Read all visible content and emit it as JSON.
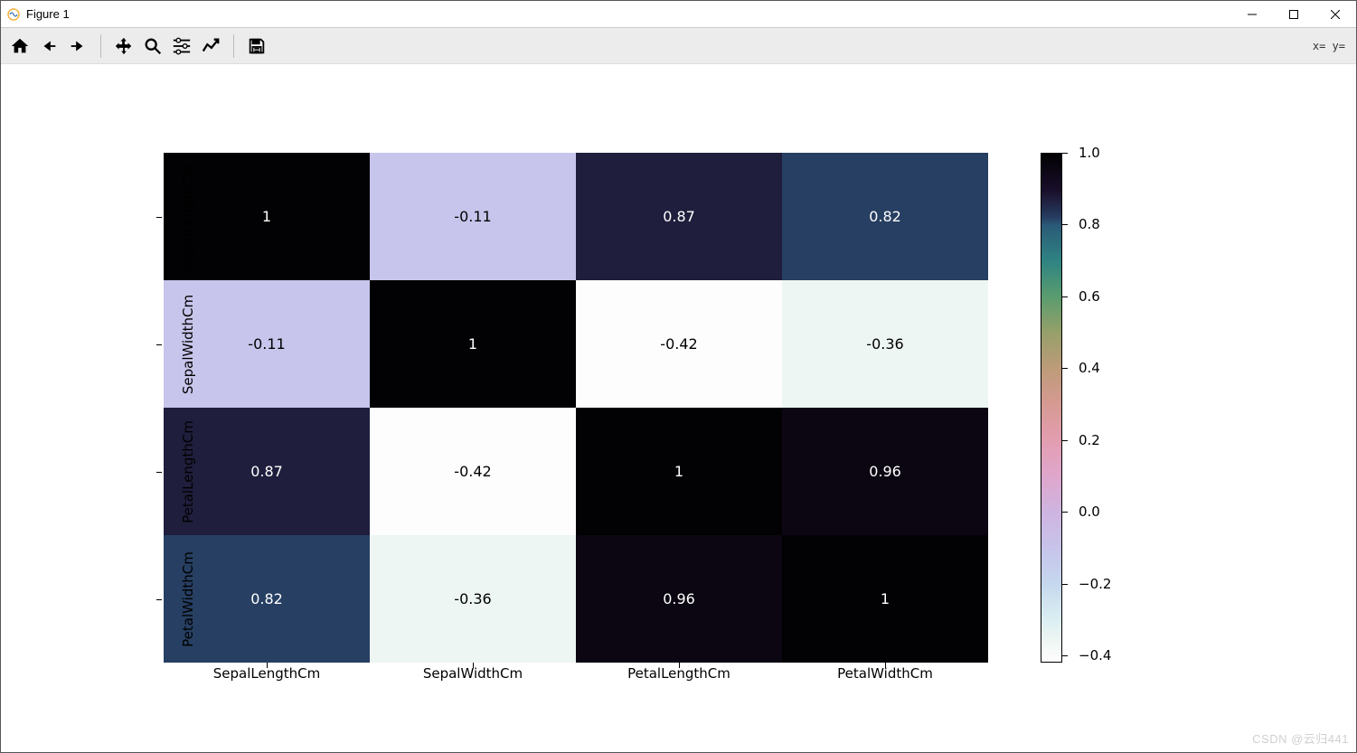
{
  "window": {
    "title": "Figure 1"
  },
  "toolbar": {
    "coord_text": "x=  y="
  },
  "watermark": "CSDN @云归441",
  "chart_data": {
    "type": "heatmap",
    "xlabels": [
      "SepalLengthCm",
      "SepalWidthCm",
      "PetalLengthCm",
      "PetalWidthCm"
    ],
    "ylabels": [
      "SepalLengthCm",
      "SepalWidthCm",
      "PetalLengthCm",
      "PetalWidthCm"
    ],
    "values": [
      [
        1,
        -0.11,
        0.87,
        0.82
      ],
      [
        -0.11,
        1,
        -0.42,
        -0.36
      ],
      [
        0.87,
        -0.42,
        1,
        0.96
      ],
      [
        0.82,
        -0.36,
        0.96,
        1
      ]
    ],
    "annotations": [
      [
        "1",
        "-0.11",
        "0.87",
        "0.82"
      ],
      [
        "-0.11",
        "1",
        "-0.42",
        "-0.36"
      ],
      [
        "0.87",
        "-0.42",
        "1",
        "0.96"
      ],
      [
        "0.82",
        "-0.36",
        "0.96",
        "1"
      ]
    ],
    "vmin": -0.42,
    "vmax": 1.0,
    "colorbar": {
      "ticks": [
        1.0,
        0.8,
        0.6,
        0.4,
        0.2,
        0.0,
        -0.2,
        -0.4
      ],
      "tick_labels": [
        "1.0",
        "0.8",
        "0.6",
        "0.4",
        "0.2",
        "0.0",
        "−0.2",
        "−0.4"
      ]
    },
    "colormap_stops": [
      {
        "v": -0.42,
        "c": "#fdfdfd"
      },
      {
        "v": -0.4,
        "c": "#f9fbfa"
      },
      {
        "v": -0.36,
        "c": "#edf6f2"
      },
      {
        "v": -0.3,
        "c": "#daeef2"
      },
      {
        "v": -0.2,
        "c": "#c5d7ee"
      },
      {
        "v": -0.11,
        "c": "#c7c5eb"
      },
      {
        "v": 0.0,
        "c": "#ceb4e0"
      },
      {
        "v": 0.1,
        "c": "#dfa6cc"
      },
      {
        "v": 0.2,
        "c": "#e39db0"
      },
      {
        "v": 0.3,
        "c": "#d69a92"
      },
      {
        "v": 0.4,
        "c": "#bd9b79"
      },
      {
        "v": 0.5,
        "c": "#96a06a"
      },
      {
        "v": 0.6,
        "c": "#5a9c6f"
      },
      {
        "v": 0.7,
        "c": "#2f8382"
      },
      {
        "v": 0.8,
        "c": "#2a5a77"
      },
      {
        "v": 0.82,
        "c": "#273f62"
      },
      {
        "v": 0.87,
        "c": "#1f1e3d"
      },
      {
        "v": 0.9,
        "c": "#180e2a"
      },
      {
        "v": 0.96,
        "c": "#0b0612"
      },
      {
        "v": 1.0,
        "c": "#020103"
      }
    ]
  }
}
